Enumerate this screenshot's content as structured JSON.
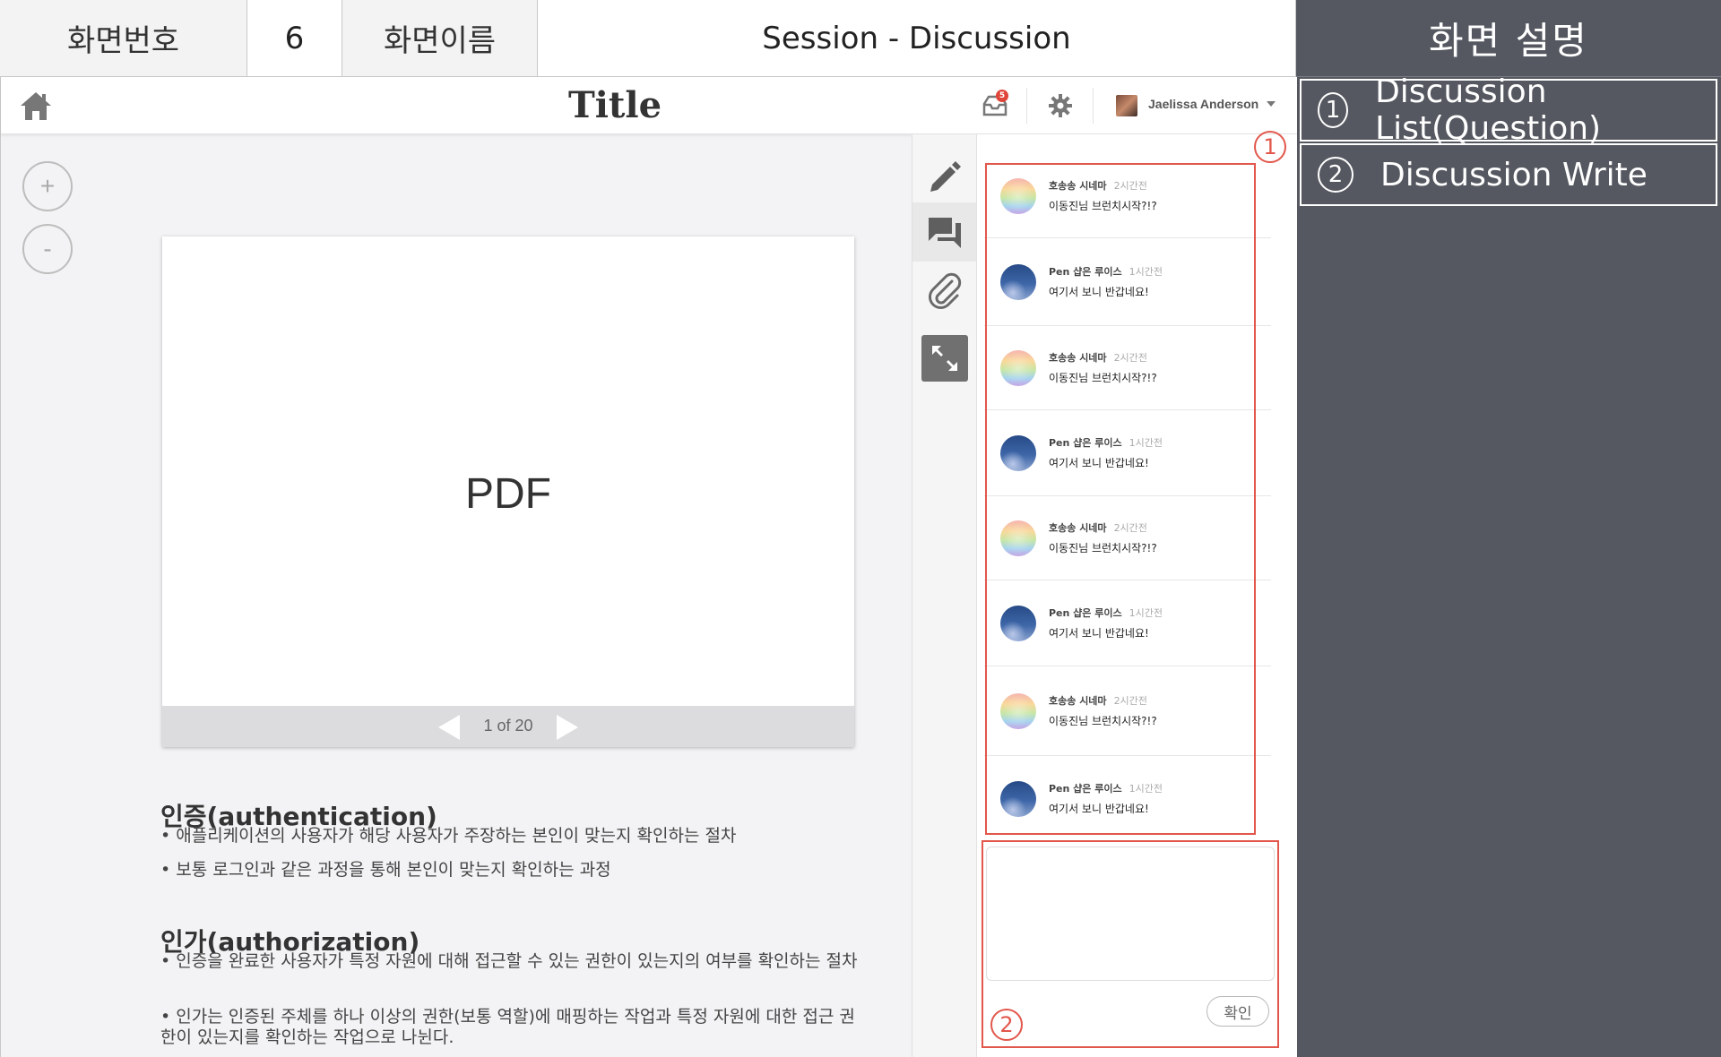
{
  "spec_header": {
    "screen_number_label": "화면번호",
    "screen_number": "6",
    "screen_name_label": "화면이름",
    "screen_name": "Session - Discussion"
  },
  "description_panel": {
    "title": "화면 설명",
    "items": [
      {
        "num": "1",
        "label": "Discussion List(Question)"
      },
      {
        "num": "2",
        "label": "Discussion Write"
      }
    ]
  },
  "topbar": {
    "title": "Title",
    "inbox_badge": "5",
    "user_name": "Jaelissa Anderson"
  },
  "viewer": {
    "zoom_in": "+",
    "zoom_out": "-",
    "pdf_label": "PDF",
    "page_indicator": "1 of 20"
  },
  "content": {
    "auth_title": "인증(authentication)",
    "auth_lines": [
      "• 애플리케이션의 사용자가 해당 사용자가 주장하는 본인이 맞는지 확인하는 절차",
      "• 보통 로그인과 같은 과정을 통해 본인이 맞는지 확인하는 과정"
    ],
    "authz_title": "인가(authorization)",
    "authz_lines": [
      "• 인증을 완료한 사용자가 특정 자원에 대해 접근할 수 있는 권한이 있는지의 여부를 확인하는 절차",
      "• 인가는 인증된 주체를 하나 이상의 권한(보통 역할)에 매핑하는 작업과 특정 자원에 대한 접근 권한이 있는지를 확인하는 작업으로 나뉜다."
    ]
  },
  "discussion": {
    "items": [
      {
        "author": "호송송 시네마",
        "time": "2시간전",
        "text": "이동진님 브런치시작?!?",
        "avatar": "rainbow"
      },
      {
        "author": "Pen 샵은 루이스",
        "time": "1시간전",
        "text": "여기서 보니 반갑네요!",
        "avatar": "night"
      },
      {
        "author": "호송송 시네마",
        "time": "2시간전",
        "text": "이동진님 브런치시작?!?",
        "avatar": "rainbow"
      },
      {
        "author": "Pen 샵은 루이스",
        "time": "1시간전",
        "text": "여기서 보니 반갑네요!",
        "avatar": "night"
      },
      {
        "author": "호송송 시네마",
        "time": "2시간전",
        "text": "이동진님 브런치시작?!?",
        "avatar": "rainbow"
      },
      {
        "author": "Pen 샵은 루이스",
        "time": "1시간전",
        "text": "여기서 보니 반갑네요!",
        "avatar": "night"
      },
      {
        "author": "호송송 시네마",
        "time": "2시간전",
        "text": "이동진님 브런치시작?!?",
        "avatar": "rainbow"
      },
      {
        "author": "Pen 샵은 루이스",
        "time": "1시간전",
        "text": "여기서 보니 반갑네요!",
        "avatar": "night"
      }
    ],
    "write_value": "",
    "confirm_label": "확인"
  },
  "annotations": {
    "list_num": "1",
    "write_num": "2"
  },
  "colors": {
    "annotation": "#e2574c",
    "desc_panel_bg": "#555860",
    "badge": "#e0453a"
  }
}
